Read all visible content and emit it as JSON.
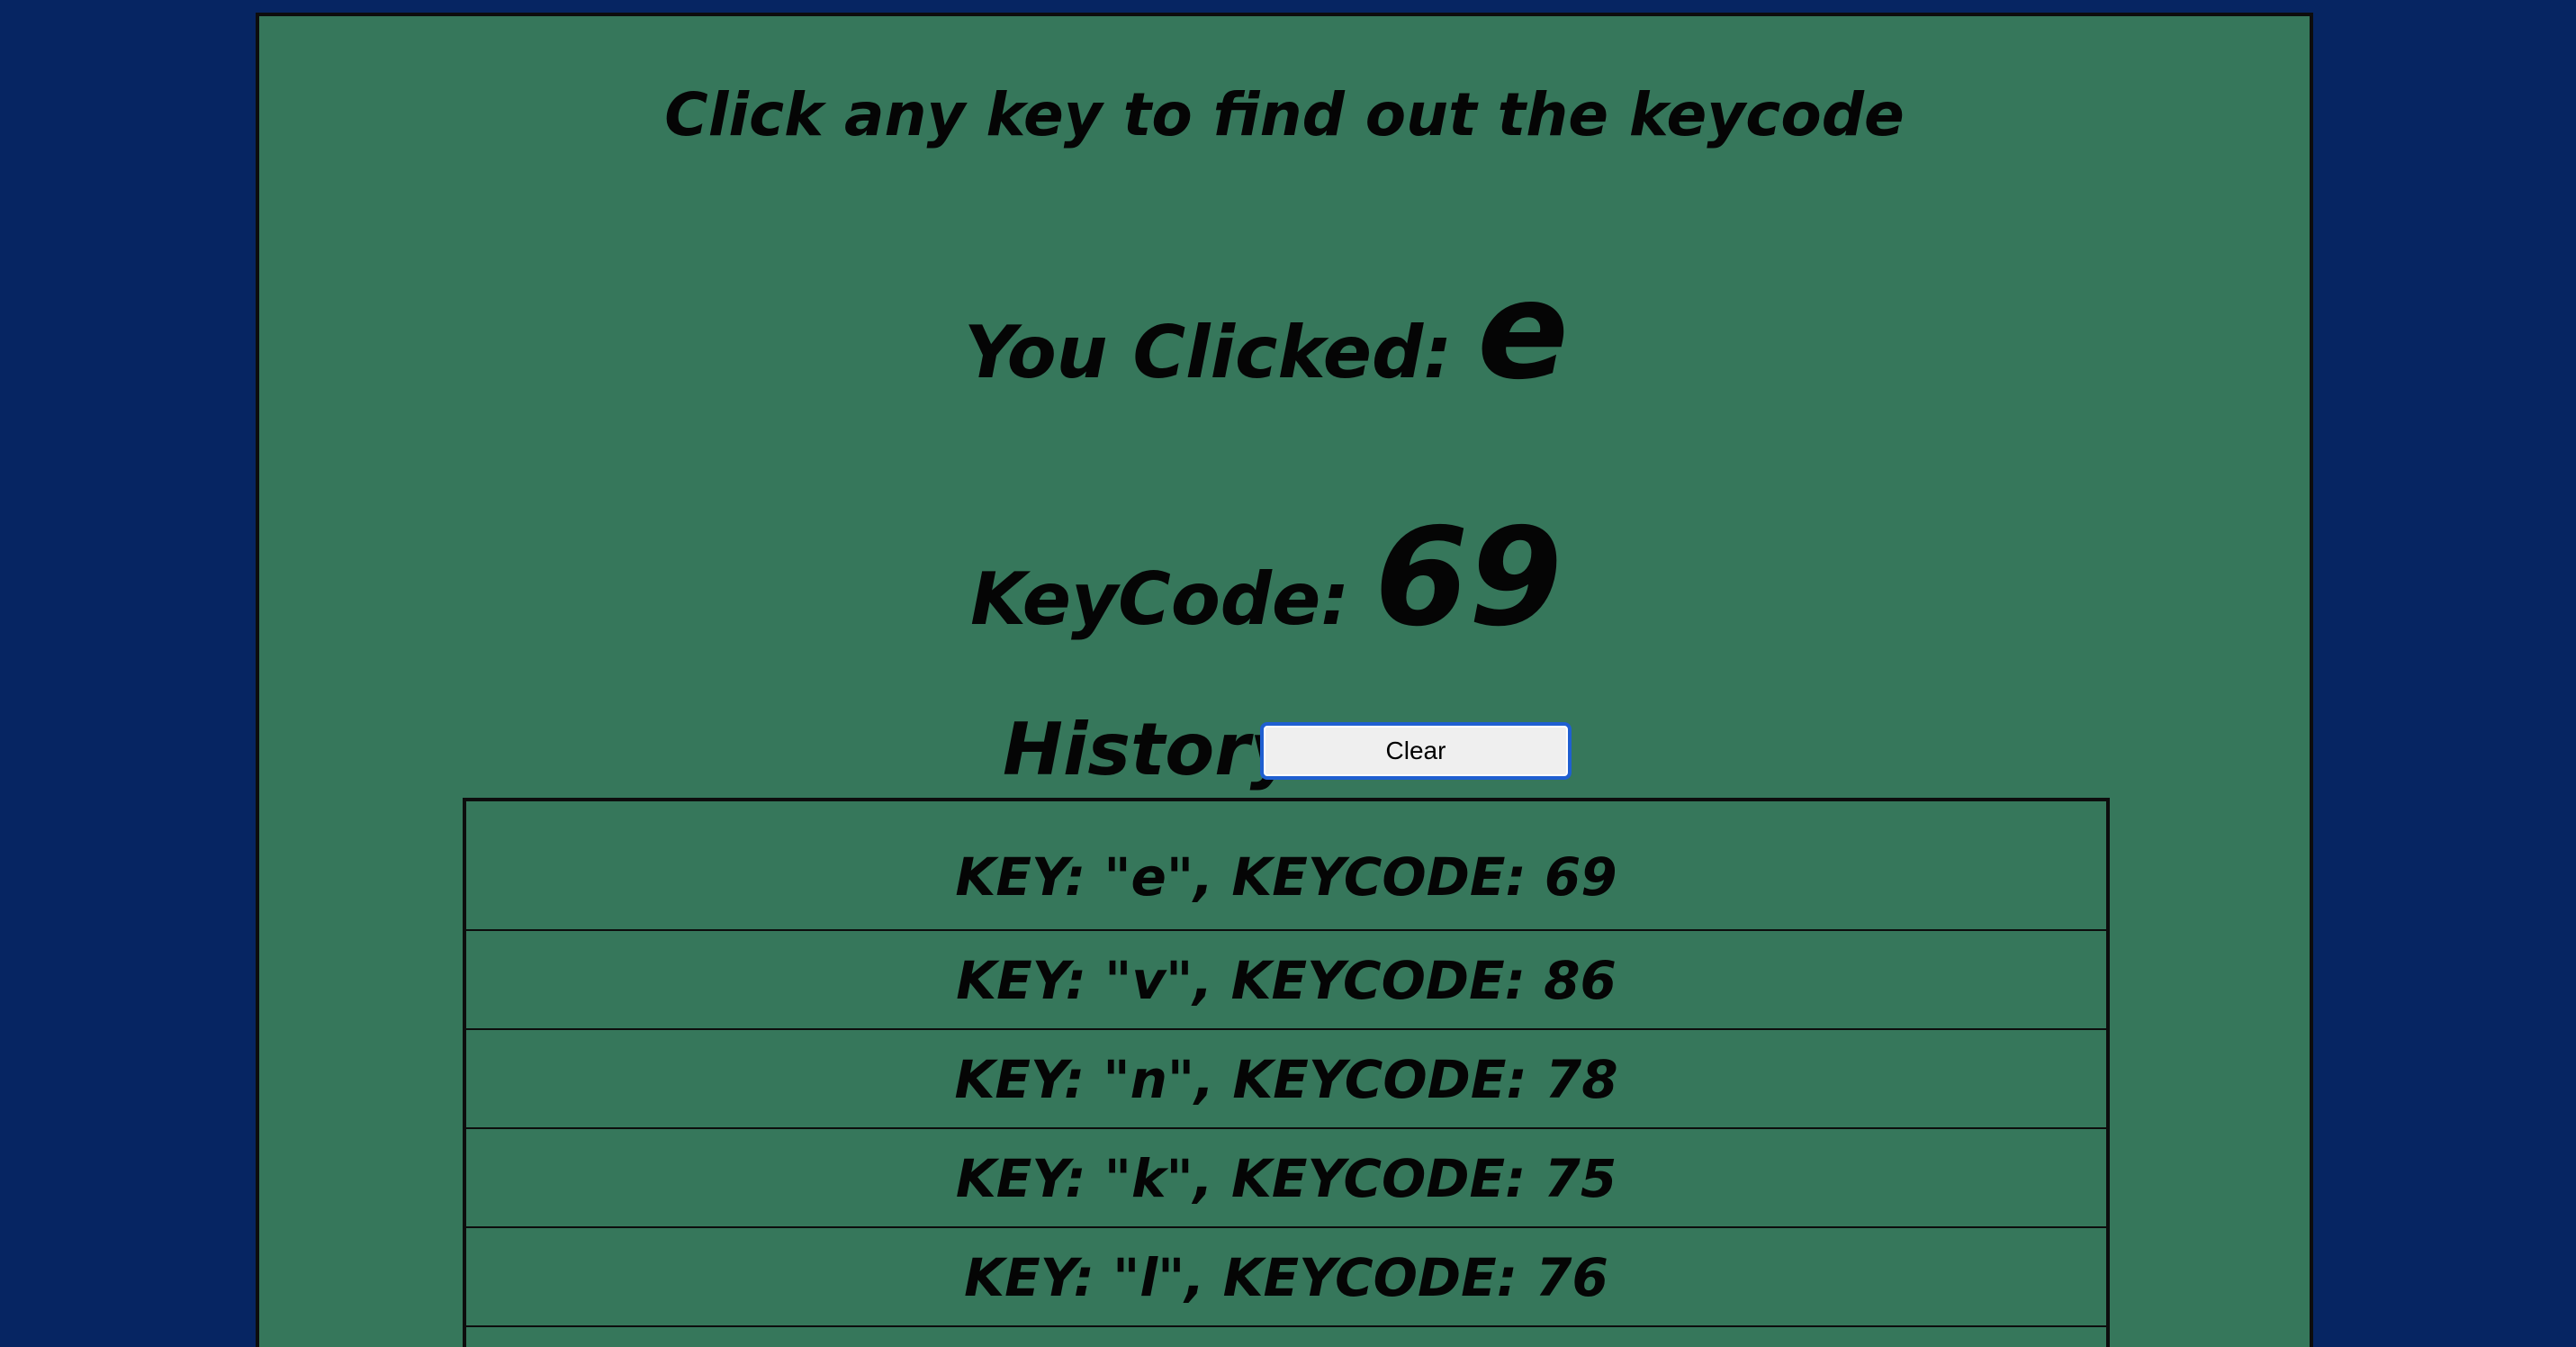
{
  "page": {
    "title": "Click any key to find out the keycode",
    "clicked_label": "You Clicked:",
    "clicked_value": "e",
    "keycode_label": "KeyCode:",
    "keycode_value": "69"
  },
  "history": {
    "title": "History",
    "clear_label": "Clear",
    "items": [
      "KEY: \"e\", KEYCODE: 69",
      "KEY: \"v\", KEYCODE: 86",
      "KEY: \"n\", KEYCODE: 78",
      "KEY: \"k\", KEYCODE: 75",
      "KEY: \"l\", KEYCODE: 76"
    ]
  },
  "colors": {
    "background": "#062562",
    "panel": "#36775B",
    "text": "#050505",
    "button_border": "#1f5fd1"
  }
}
